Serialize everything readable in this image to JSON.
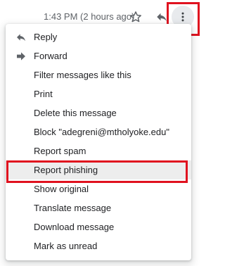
{
  "header": {
    "timestamp": "1:43 PM (2 hours ago)",
    "icons": [
      "star-icon",
      "reply-icon",
      "more-vert-icon"
    ]
  },
  "menu": {
    "items": [
      {
        "label": "Reply",
        "icon": "reply-icon"
      },
      {
        "label": "Forward",
        "icon": "forward-icon"
      },
      {
        "label": "Filter messages like this"
      },
      {
        "label": "Print"
      },
      {
        "label": "Delete this message"
      },
      {
        "label": "Block \"adegreni@mtholyoke.edu\""
      },
      {
        "label": "Report spam"
      },
      {
        "label": "Report phishing",
        "highlighted": true
      },
      {
        "label": "Show original"
      },
      {
        "label": "Translate message"
      },
      {
        "label": "Download message"
      },
      {
        "label": "Mark as unread"
      }
    ]
  },
  "colors": {
    "highlight_border": "#e0121f",
    "icon": "#5f6368",
    "text": "#202124",
    "hover_bg": "#ededed"
  }
}
